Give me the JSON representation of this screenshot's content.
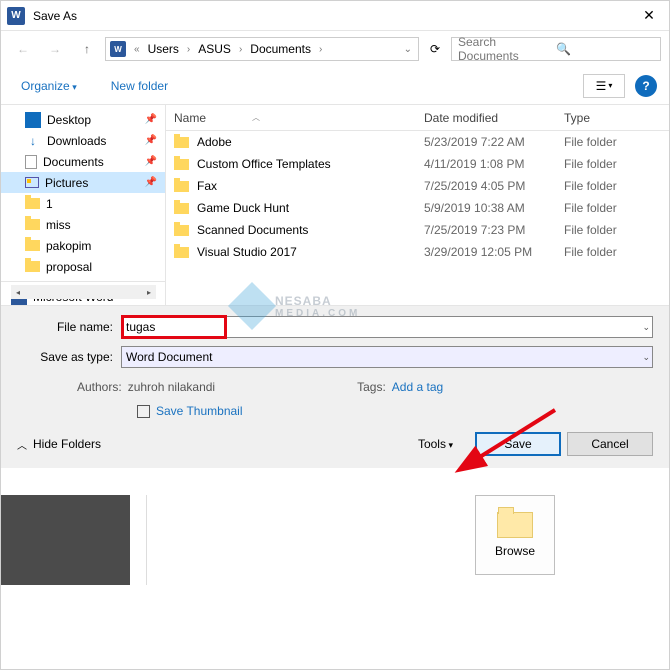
{
  "title": "Save As",
  "breadcrumb": {
    "root_glyph": "«",
    "segments": [
      "Users",
      "ASUS",
      "Documents"
    ]
  },
  "search": {
    "placeholder": "Search Documents"
  },
  "toolbar": {
    "organize": "Organize",
    "new_folder": "New folder"
  },
  "tree": {
    "items": [
      {
        "label": "Desktop",
        "icon": "desktop",
        "pinned": true
      },
      {
        "label": "Downloads",
        "icon": "download",
        "pinned": true
      },
      {
        "label": "Documents",
        "icon": "document",
        "pinned": true
      },
      {
        "label": "Pictures",
        "icon": "picture",
        "pinned": true,
        "selected": true
      },
      {
        "label": "1",
        "icon": "folder"
      },
      {
        "label": "miss",
        "icon": "folder"
      },
      {
        "label": "pakopim",
        "icon": "folder"
      },
      {
        "label": "proposal",
        "icon": "folder"
      }
    ],
    "app_item": {
      "label": "Microsoft Word"
    }
  },
  "filelist": {
    "headers": {
      "name": "Name",
      "date": "Date modified",
      "type": "Type"
    },
    "rows": [
      {
        "name": "Adobe",
        "date": "5/23/2019 7:22 AM",
        "type": "File folder"
      },
      {
        "name": "Custom Office Templates",
        "date": "4/11/2019 1:08 PM",
        "type": "File folder"
      },
      {
        "name": "Fax",
        "date": "7/25/2019 4:05 PM",
        "type": "File folder"
      },
      {
        "name": "Game Duck Hunt",
        "date": "5/9/2019 10:38 AM",
        "type": "File folder"
      },
      {
        "name": "Scanned Documents",
        "date": "7/25/2019 7:23 PM",
        "type": "File folder"
      },
      {
        "name": "Visual Studio 2017",
        "date": "3/29/2019 12:05 PM",
        "type": "File folder"
      }
    ]
  },
  "fields": {
    "filename_label": "File name:",
    "filename_value": "tugas",
    "saveastype_label": "Save as type:",
    "saveastype_value": "Word Document"
  },
  "meta": {
    "authors_label": "Authors:",
    "authors_value": "zuhroh nilakandi",
    "tags_label": "Tags:",
    "tags_value": "Add a tag",
    "thumbnail_label": "Save Thumbnail"
  },
  "actions": {
    "hide_folders": "Hide Folders",
    "tools": "Tools",
    "save": "Save",
    "cancel": "Cancel"
  },
  "browse": {
    "label": "Browse"
  },
  "watermark": {
    "brand": "NESABA",
    "sub": "MEDIA.COM"
  }
}
